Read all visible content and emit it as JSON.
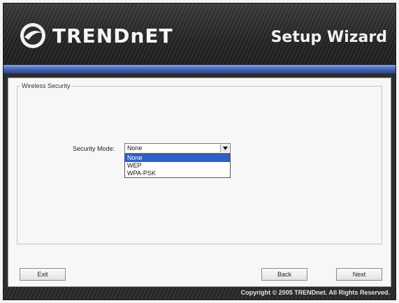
{
  "header": {
    "brand": "TRENDnET",
    "title": "Setup Wizard",
    "logo_icon": "trendnet-globe-icon"
  },
  "colors": {
    "accent_bar": "#4c67b5",
    "selected_option": "#2c5fc9",
    "header_bg": "#2d2d2d"
  },
  "wireless_security": {
    "group_title": "Wireless Security",
    "security_mode_label": "Security Mode:",
    "selected_value": "None",
    "options": [
      "None",
      "WEP",
      "WPA-PSK"
    ],
    "highlighted_option": "None",
    "dropdown_open": true
  },
  "buttons": {
    "exit": "Exit",
    "back": "Back",
    "next": "Next"
  },
  "footer": {
    "copyright": "Copyright © 2005 TRENDnet. All Rights Reserved."
  }
}
